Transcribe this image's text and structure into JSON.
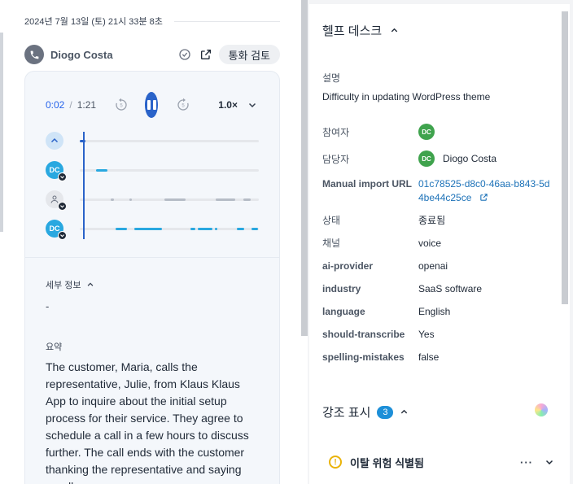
{
  "call": {
    "datetime": "2024년 7월 13일 (토) 21시 33분 8초",
    "caller_name": "Diogo Costa",
    "review_label": "통화 검토"
  },
  "player": {
    "current_time": "0:02",
    "separator": "/",
    "total_time": "1:21",
    "speed": "1.0×",
    "tracks": [
      {
        "id": "collapse",
        "initials": ""
      },
      {
        "id": "agent",
        "initials": "DC"
      },
      {
        "id": "customer",
        "initials": ""
      },
      {
        "id": "agent-2",
        "initials": "DC"
      }
    ]
  },
  "details": {
    "heading": "세부 정보",
    "value": "-"
  },
  "summary": {
    "heading": "요약",
    "text": "The customer, Maria, calls the representative, Julie, from Klaus Klaus App to inquire about the initial setup process for their service. They agree to schedule a call in a few hours to discuss further. The call ends with the customer thanking the representative and saying goodbye."
  },
  "helpdesk": {
    "title": "헬프 데스크",
    "description_label": "설명",
    "description": "Difficulty in updating WordPress theme",
    "participants_label": "참여자",
    "assignee_label": "담당자",
    "assignee_initials": "DC",
    "assignee_name": "Diogo Costa",
    "participant_initials": "DC",
    "url_label": "Manual import URL",
    "url_value": "01c78525-d8c0-46aa-b843-5d4be44c25ce",
    "fields": [
      {
        "label": "상태",
        "value": "종료됨"
      },
      {
        "label": "채널",
        "value": "voice"
      },
      {
        "label": "ai-provider",
        "value": "openai"
      },
      {
        "label": "industry",
        "value": "SaaS software"
      },
      {
        "label": "language",
        "value": "English"
      },
      {
        "label": "should-transcribe",
        "value": "Yes"
      },
      {
        "label": "spelling-mistakes",
        "value": "false"
      }
    ]
  },
  "highlights": {
    "title": "강조 표시",
    "count": "3",
    "item_label": "이탈 위험 식별됨",
    "more": "···"
  },
  "colors": {
    "accent": "#2a63c9",
    "agent_track": "#29a8e0",
    "customer_track": "#b6bcc6",
    "avatar_green": "#3fa34d",
    "link": "#1d72b8"
  }
}
